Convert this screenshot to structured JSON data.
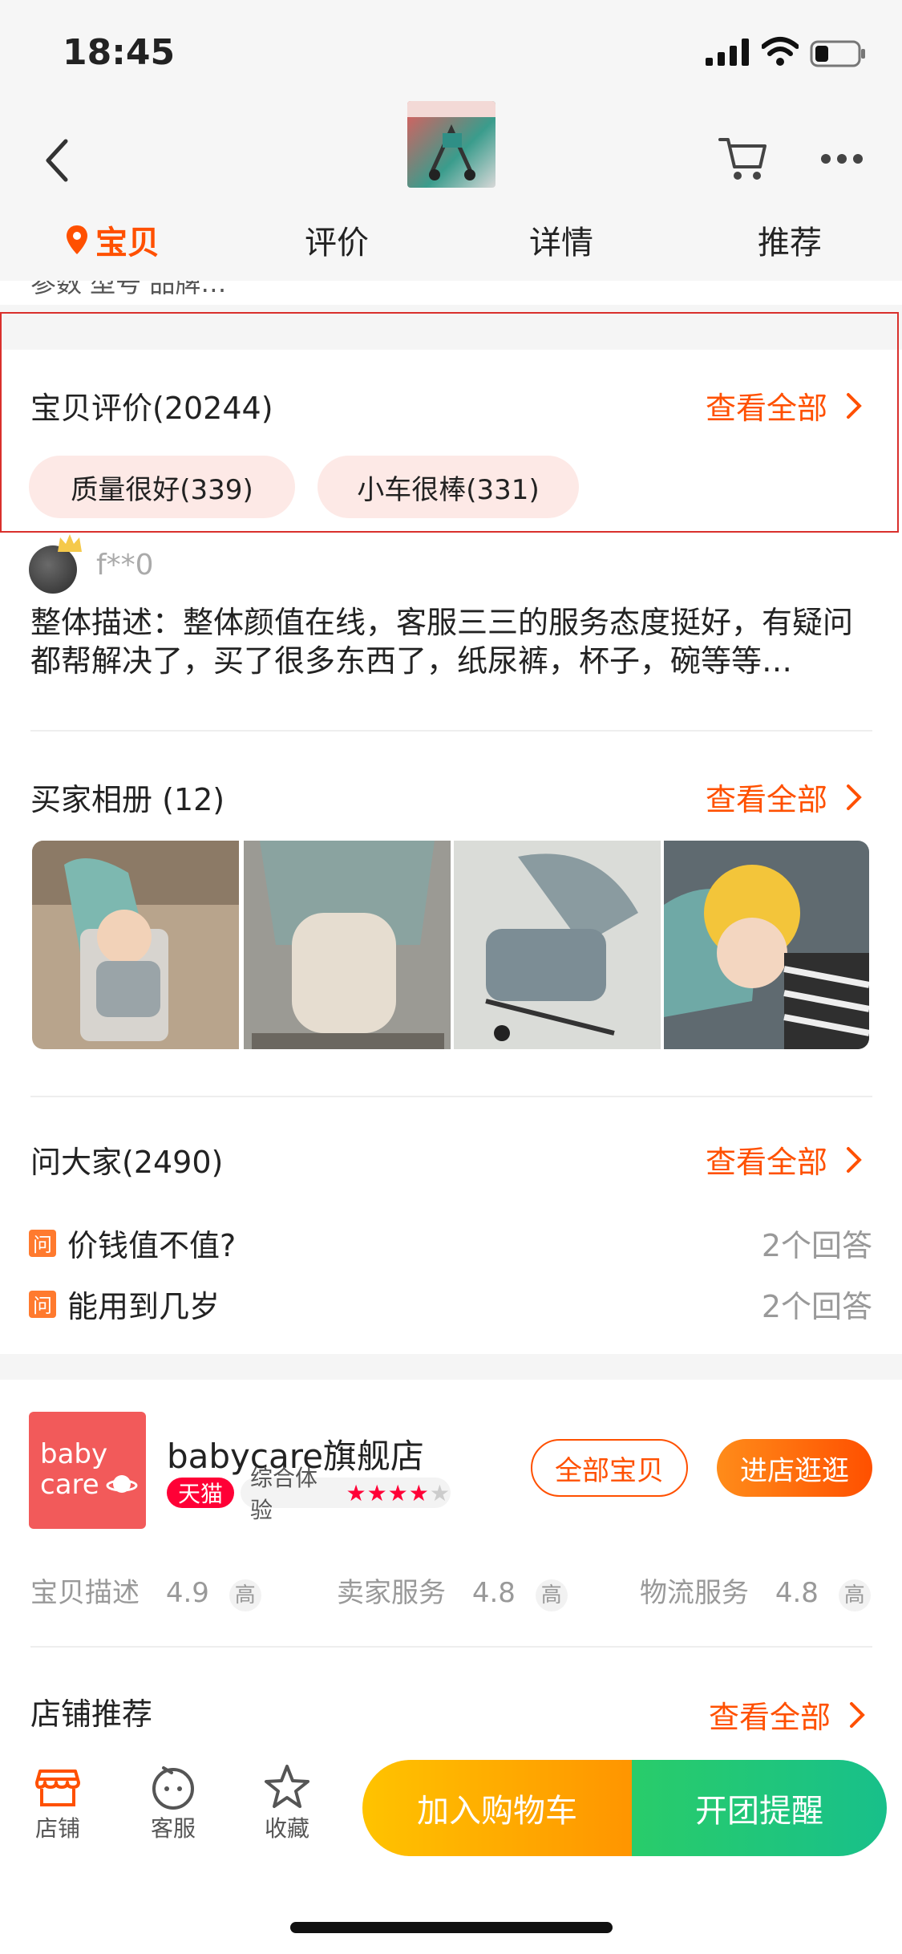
{
  "status_bar": {
    "time": "18:45"
  },
  "nav": {
    "tabs": [
      "宝贝",
      "评价",
      "详情",
      "推荐"
    ],
    "params_partial": "参数    型号  品牌…"
  },
  "reviews": {
    "title": "宝贝评价(20244)",
    "see_all": "查看全部",
    "tags": [
      "质量很好(339)",
      "小车很棒(331)"
    ],
    "reviewer": "f**0",
    "text": "整体描述：整体颜值在线，客服三三的服务态度挺好，有疑问都帮解决了，买了很多东西了，纸尿裤，杯子，碗等等…"
  },
  "album": {
    "title": "买家相册 (12)",
    "see_all": "查看全部",
    "photos": [
      "stroller-baby-photo",
      "stroller-seat-photo",
      "stroller-canopy-photo",
      "baby-yellow-hat-photo"
    ]
  },
  "ask": {
    "title": "问大家(2490)",
    "see_all": "查看全部",
    "icon_label": "问",
    "questions": [
      {
        "q": "价钱值不值?",
        "answers": "2个回答"
      },
      {
        "q": "能用到几岁",
        "answers": "2个回答"
      }
    ]
  },
  "store": {
    "logo_line1": "baby",
    "logo_line2": "care",
    "name": "babycare旗舰店",
    "tmall": "天猫",
    "experience": "综合体验",
    "rating_stars": 4,
    "btn_all": "全部宝贝",
    "btn_enter": "进店逛逛",
    "scores": [
      {
        "label": "宝贝描述",
        "value": "4.9",
        "level": "高"
      },
      {
        "label": "卖家服务",
        "value": "4.8",
        "level": "高"
      },
      {
        "label": "物流服务",
        "value": "4.8",
        "level": "高"
      }
    ],
    "recommend_title": "店铺推荐",
    "recommend_see_all": "查看全部"
  },
  "bottom_bar": {
    "shop": "店铺",
    "service": "客服",
    "favorite": "收藏",
    "add_cart": "加入购物车",
    "remind": "开团提醒"
  },
  "colors": {
    "accent": "#ff5000",
    "highlight_border": "#d9302c",
    "tag_bg": "#fde9e6"
  }
}
